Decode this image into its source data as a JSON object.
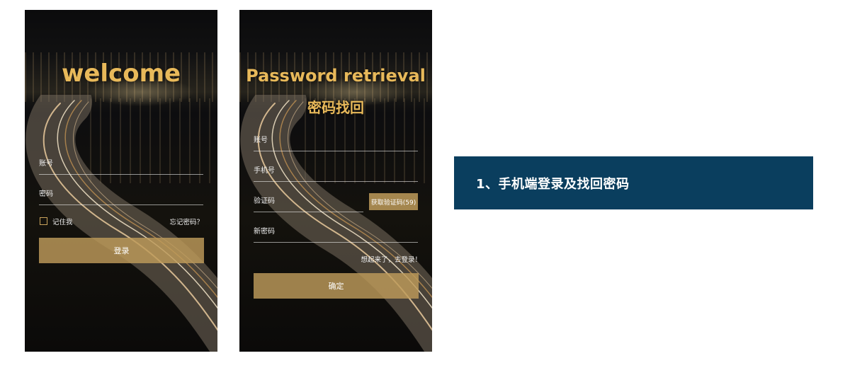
{
  "login": {
    "title": "welcome",
    "account_label": "账号",
    "password_label": "密码",
    "remember_label": "记住我",
    "forgot_link": "忘记密码？",
    "login_button": "登录"
  },
  "retrieve": {
    "title_en": "Password retrieval",
    "title_cn": "密码找回",
    "account_label": "账号",
    "phone_label": "手机号",
    "code_label": "验证码",
    "code_button": "获取验证码(59)",
    "new_password_label": "新密码",
    "back_to_login": "想起来了，去登录！",
    "confirm_button": "确定"
  },
  "banner": {
    "text": "1、手机端登录及找回密码"
  },
  "colors": {
    "gold_title": "#e8b95a",
    "button_gold": "#be9b5a",
    "banner_blue": "#0a3e5e"
  },
  "icons": {
    "checkbox": "checkbox-icon"
  }
}
